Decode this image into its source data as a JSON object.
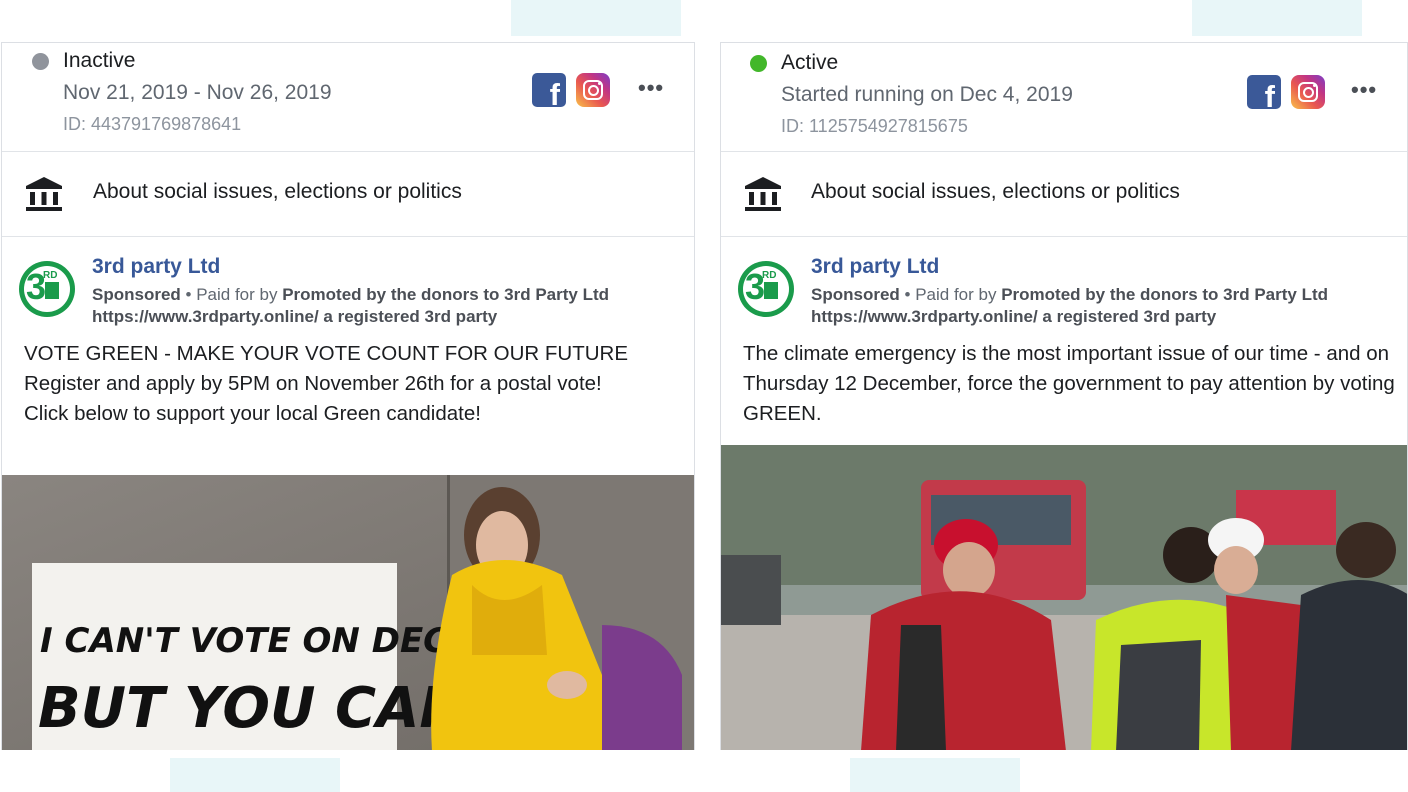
{
  "ads": [
    {
      "status": "Inactive",
      "status_color": "#90949c",
      "dates": "Nov 21, 2019 - Nov 26, 2019",
      "id": "ID: 443791769878641",
      "platforms": [
        "facebook-icon",
        "instagram-icon"
      ],
      "category": "About social issues, elections or politics",
      "page_name": "3rd party Ltd",
      "sponsored": "Sponsored",
      "separator": " • ",
      "paid_for_by": "Paid for by ",
      "funder": "Promoted by the donors to 3rd Party Ltd https://www.3rdparty.online/ a registered 3rd party",
      "body": "VOTE GREEN - MAKE YOUR VOTE COUNT FOR OUR FUTURE\nRegister and apply by 5PM on November 26th for a postal vote!\nClick below to support your local Green candidate!",
      "image_text": [
        "I CAN'T VOTE ON DEC 12",
        "BUT YOU CAN"
      ]
    },
    {
      "status": "Active",
      "status_color": "#42b72a",
      "dates": "Started running on Dec 4, 2019",
      "id": "ID: 1125754927815675",
      "platforms": [
        "facebook-icon",
        "instagram-icon"
      ],
      "category": "About social issues, elections or politics",
      "page_name": "3rd party Ltd",
      "sponsored": "Sponsored",
      "separator": " • ",
      "paid_for_by": "Paid for by ",
      "funder": "Promoted by the donors to 3rd Party Ltd https://www.3rdparty.online/ a registered 3rd party",
      "body": "The climate emergency is the most important issue of our time - and on Thursday 12 December, force the government to pay attention by voting GREEN."
    }
  ],
  "logo_text": {
    "number": "3",
    "superscript": "RD"
  },
  "more_label": "•••",
  "colors": {
    "facebook": "#3b5998",
    "brand_green": "#1a9b4b",
    "link_blue": "#385898"
  }
}
